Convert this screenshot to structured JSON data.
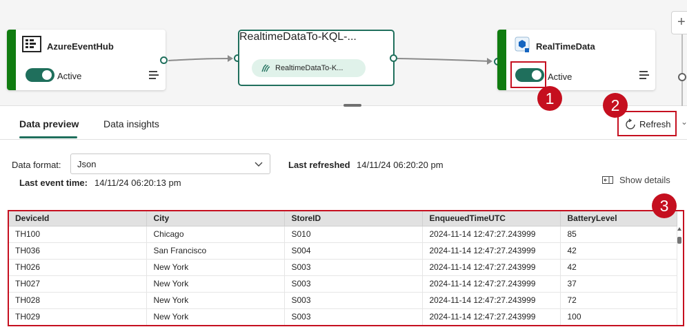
{
  "canvas": {
    "source_node": {
      "title": "AzureEventHub",
      "toggle_label": "Active"
    },
    "operator_node": {
      "title": "RealtimeDataTo-KQL-...",
      "chip_label": "RealtimeDataTo-K..."
    },
    "destination_node": {
      "title": "RealTimeData",
      "toggle_label": "Active"
    }
  },
  "annotations": {
    "badge_1": "1",
    "badge_2": "2",
    "badge_3": "3"
  },
  "tabs": [
    {
      "label": "Data preview",
      "active": true
    },
    {
      "label": "Data insights",
      "active": false
    }
  ],
  "toolbar": {
    "refresh_label": "Refresh",
    "show_details_label": "Show details"
  },
  "preview": {
    "format_label": "Data format:",
    "format_value": "Json",
    "last_refreshed_label": "Last refreshed",
    "last_refreshed_value": "14/11/24 06:20:20 pm",
    "last_event_label": "Last event time:",
    "last_event_value": "14/11/24 06:20:13 pm"
  },
  "table": {
    "columns": [
      "DeviceId",
      "City",
      "StoreID",
      "EnqueuedTimeUTC",
      "BatteryLevel"
    ],
    "rows": [
      [
        "TH100",
        "Chicago",
        "S010",
        "2024-11-14 12:47:27.243999",
        "85"
      ],
      [
        "TH036",
        "San Francisco",
        "S004",
        "2024-11-14 12:47:27.243999",
        "42"
      ],
      [
        "TH026",
        "New York",
        "S003",
        "2024-11-14 12:47:27.243999",
        "42"
      ],
      [
        "TH027",
        "New York",
        "S003",
        "2024-11-14 12:47:27.243999",
        "37"
      ],
      [
        "TH028",
        "New York",
        "S003",
        "2024-11-14 12:47:27.243999",
        "72"
      ],
      [
        "TH029",
        "New York",
        "S003",
        "2024-11-14 12:47:27.243999",
        "100"
      ]
    ]
  },
  "colors": {
    "accent": "#1f6f5c",
    "node_bar": "#107c10",
    "annotation": "#c50f1f"
  }
}
